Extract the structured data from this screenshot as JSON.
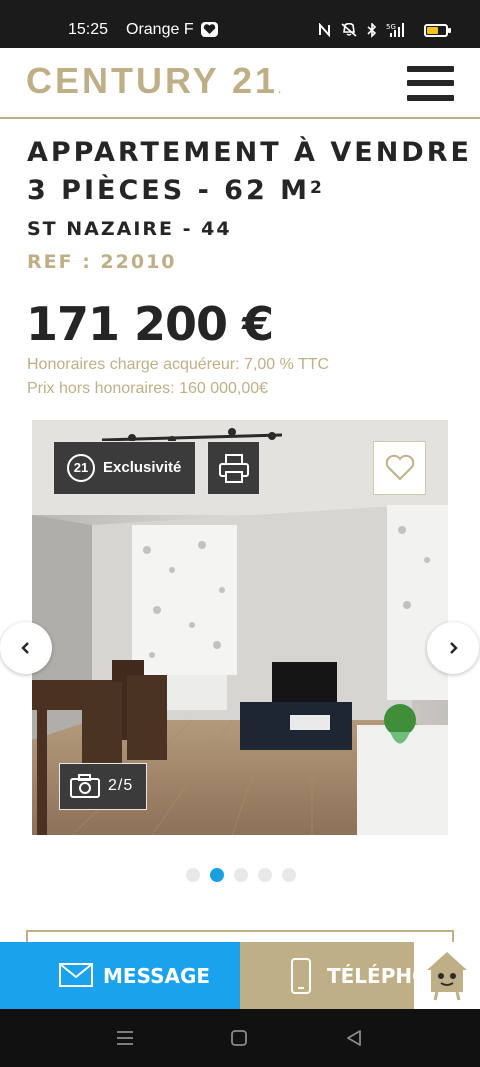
{
  "status_bar": {
    "time": "15:25",
    "carrier": "Orange F",
    "network": "5G"
  },
  "header": {
    "logo_text": "CENTURY 21",
    "logo_dot": ".",
    "menu_icon": "hamburger-menu-icon"
  },
  "listing": {
    "title_line1": "APPARTEMENT À VENDRE",
    "title_line2_prefix": "3 PIÈCES - 62 M",
    "title_line2_sup": "2",
    "location": "ST NAZAIRE - 44",
    "ref": "REF : 22010",
    "price": "171 200 €",
    "fees_line": "Honoraires charge acquéreur: 7,00 % TTC",
    "net_price_line": "Prix hors honoraires: 160 000,00€"
  },
  "gallery": {
    "badge_exclusive_logo": "21",
    "badge_exclusive_label": "Exclusivité",
    "counter": "2/5",
    "current_index": 2,
    "total": 5,
    "icons": [
      "printer-icon",
      "heart-icon",
      "camera-icon",
      "chevron-left-icon",
      "chevron-right-icon"
    ]
  },
  "actions": {
    "message_label": "MESSAGE",
    "phone_label": "TÉLÉPHONE"
  },
  "colors": {
    "gold": "#beaf87",
    "dark": "#252526",
    "blue": "#1aa3ec",
    "dot_active": "#1a9fe0"
  }
}
